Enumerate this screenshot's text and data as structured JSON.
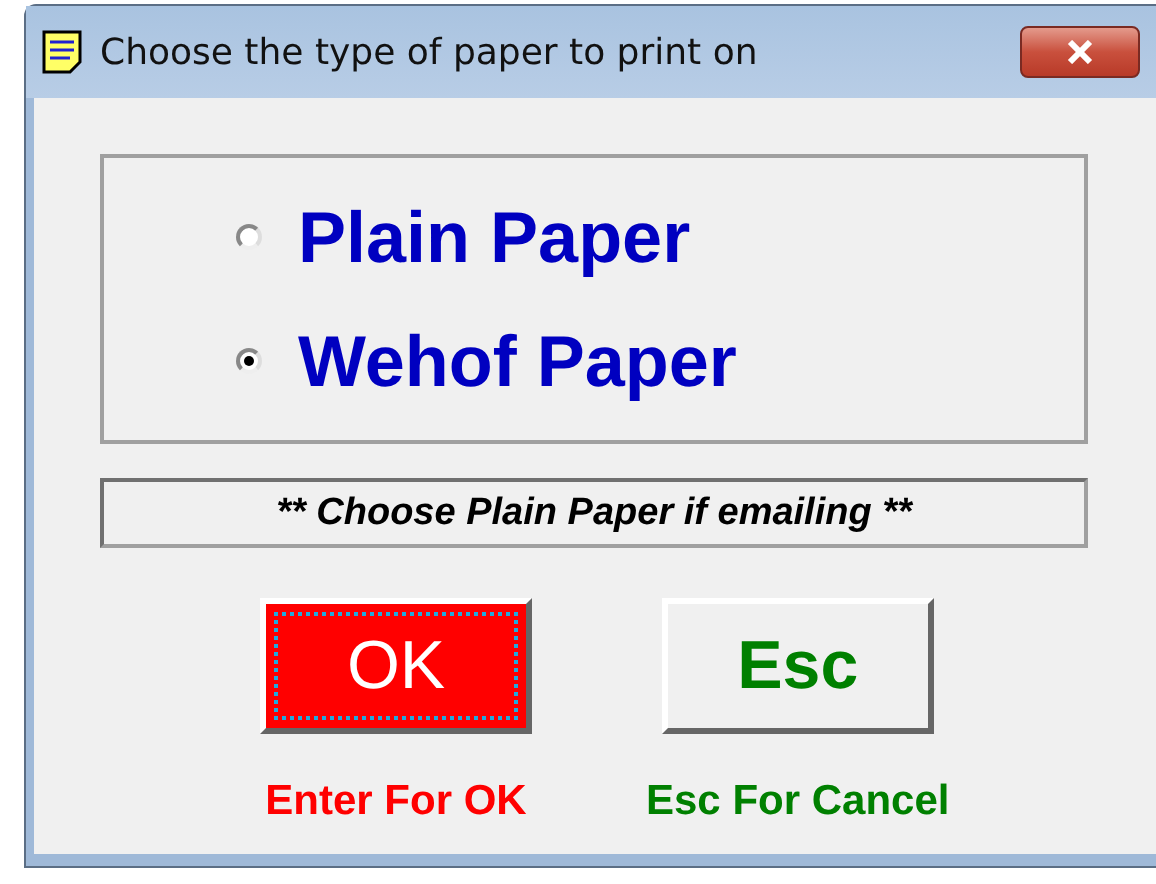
{
  "window": {
    "title": "Choose the type of paper to print on"
  },
  "options": [
    {
      "label": "Plain Paper",
      "selected": false
    },
    {
      "label": "Wehof Paper",
      "selected": true
    }
  ],
  "note": "** Choose Plain Paper if emailing **",
  "buttons": [
    {
      "label": "OK",
      "kind": "default",
      "focused": true
    },
    {
      "label": "Esc",
      "kind": "cancel",
      "focused": false
    }
  ],
  "hints": [
    {
      "text": "Enter For OK",
      "color": "#ff0000"
    },
    {
      "text": "Esc For Cancel",
      "color": "#008000"
    }
  ]
}
